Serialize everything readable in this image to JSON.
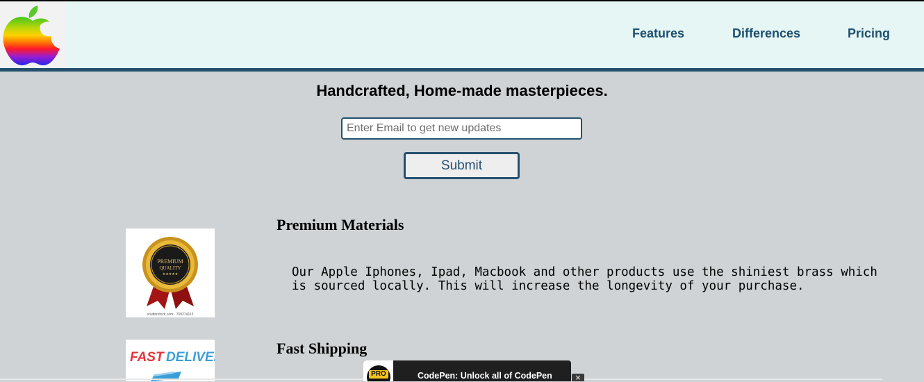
{
  "nav": {
    "features": "Features",
    "differences": "Differences",
    "pricing": "Pricing"
  },
  "hero": {
    "title": "Handcrafted, Home-made masterpieces.",
    "email_placeholder": "Enter Email to get new updates",
    "submit_label": "Submit"
  },
  "features": [
    {
      "title": "Premium Materials",
      "description": "Our Apple Iphones, Ipad, Macbook and other products use the shiniest brass which is sourced locally. This will increase the longevity of your purchase.",
      "image_icon": "premium-quality-badge",
      "badge_text_1": "PREMIUM",
      "badge_text_2": "QUALITY",
      "badge_stars": "★★★★★",
      "image_caption": "shutterstock.com · 709274113"
    },
    {
      "title": "Fast Shipping",
      "image_icon": "fast-delivery-truck",
      "image_text_1": "FAST",
      "image_text_2": "DELIVERY"
    }
  ],
  "codepen": {
    "badge": "PRO",
    "text": "CodePen: Unlock all of CodePen",
    "close": "×"
  },
  "colors": {
    "header_bg": "#e6f6f4",
    "nav_text": "#1c4f70",
    "accent_border": "#24506e",
    "page_bg": "#cfd3d5"
  }
}
